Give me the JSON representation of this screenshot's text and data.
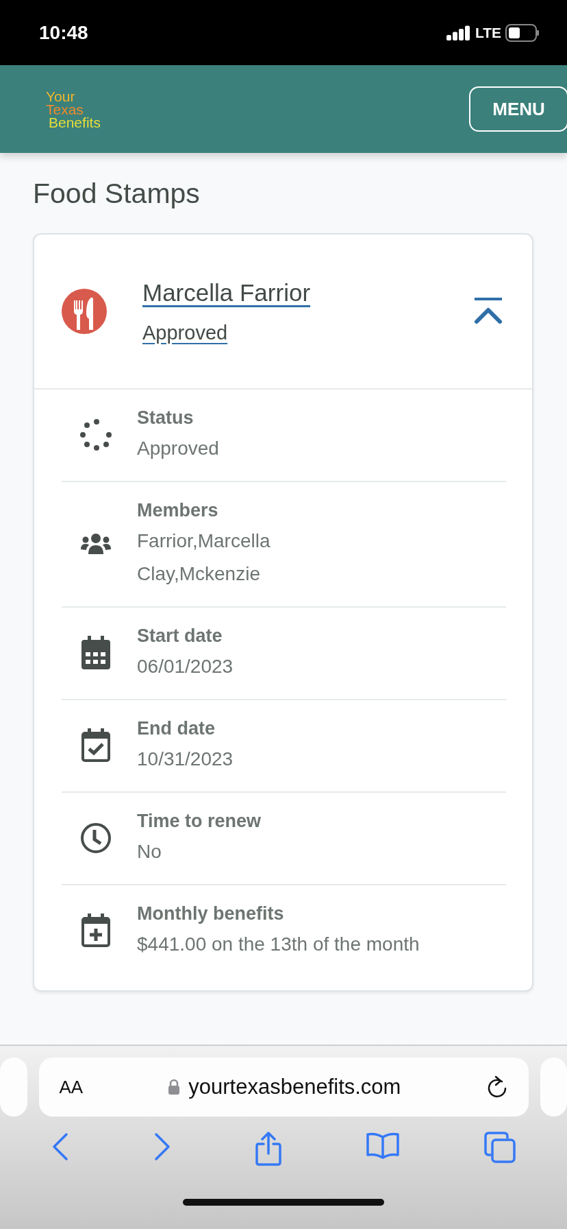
{
  "status_bar": {
    "time": "10:48",
    "network": "LTE"
  },
  "header": {
    "logo": [
      "Your",
      "Texas",
      "Benefits"
    ],
    "menu_button": "MENU"
  },
  "page_title": "Food Stamps",
  "case": {
    "name": "Marcella Farrior",
    "status": "Approved",
    "expanded": true,
    "details": [
      {
        "kind": "dots",
        "label": "Status",
        "values": [
          "Approved"
        ]
      },
      {
        "kind": "people",
        "label": "Members",
        "values": [
          "Farrior,Marcella",
          "Clay,Mckenzie"
        ]
      },
      {
        "kind": "calendar",
        "label": "Start date",
        "values": [
          "06/01/2023"
        ]
      },
      {
        "kind": "calendar-check",
        "label": "End date",
        "values": [
          "10/31/2023"
        ]
      },
      {
        "kind": "clock",
        "label": "Time to renew",
        "values": [
          "No"
        ]
      },
      {
        "kind": "calendar-plus",
        "label": "Monthly benefits",
        "values": [
          "$441.00 on the 13th of the month"
        ]
      }
    ]
  },
  "browser": {
    "text_size": "AA",
    "url": "yourtexasbenefits.com"
  }
}
